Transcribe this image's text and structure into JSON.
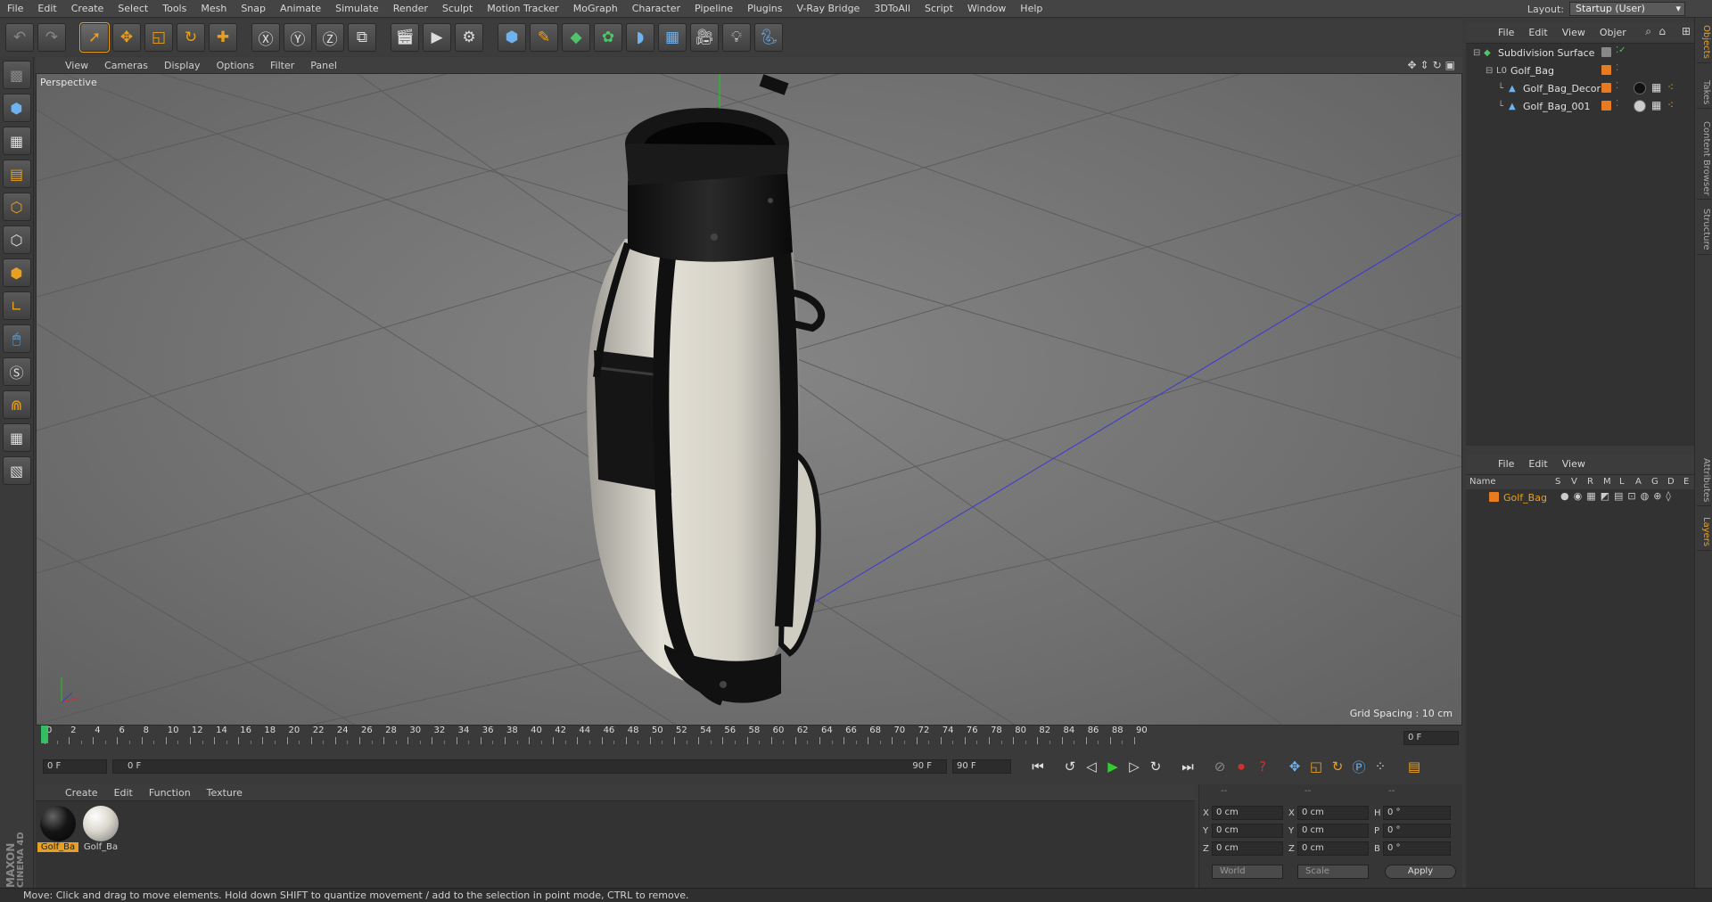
{
  "menubar": {
    "items": [
      "File",
      "Edit",
      "Create",
      "Select",
      "Tools",
      "Mesh",
      "Snap",
      "Animate",
      "Simulate",
      "Render",
      "Sculpt",
      "Motion Tracker",
      "MoGraph",
      "Character",
      "Pipeline",
      "Plugins",
      "V-Ray Bridge",
      "3DToAll",
      "Script",
      "Window",
      "Help"
    ],
    "layout_label": "Layout:",
    "layout_value": "Startup (User)"
  },
  "viewport": {
    "menu": [
      "View",
      "Cameras",
      "Display",
      "Options",
      "Filter",
      "Panel"
    ],
    "label": "Perspective",
    "grid_spacing": "Grid Spacing : 10 cm"
  },
  "timeline": {
    "ticks": [
      "0",
      "2",
      "4",
      "6",
      "8",
      "10",
      "12",
      "14",
      "16",
      "18",
      "20",
      "22",
      "24",
      "26",
      "28",
      "30",
      "32",
      "34",
      "36",
      "38",
      "40",
      "42",
      "44",
      "46",
      "48",
      "50",
      "52",
      "54",
      "56",
      "58",
      "60",
      "62",
      "64",
      "66",
      "68",
      "70",
      "72",
      "74",
      "76",
      "78",
      "80",
      "82",
      "84",
      "86",
      "88",
      "90"
    ],
    "current_frame": "0 F",
    "start_field": "0 F",
    "range_start": "0 F",
    "range_end": "90 F",
    "end_field": "90 F"
  },
  "material_manager": {
    "menu": [
      "Create",
      "Edit",
      "Function",
      "Texture"
    ],
    "materials": [
      {
        "name": "Golf_Ba",
        "color": "#151515",
        "selected": true
      },
      {
        "name": "Golf_Ba",
        "color": "#d9d6cc",
        "selected": false
      }
    ]
  },
  "coordinates": {
    "headers": [
      "--",
      "--",
      "--"
    ],
    "rows": [
      {
        "a1": "X",
        "v1": "0 cm",
        "a2": "X",
        "v2": "0 cm",
        "a3": "H",
        "v3": "0 °"
      },
      {
        "a1": "Y",
        "v1": "0 cm",
        "a2": "Y",
        "v2": "0 cm",
        "a3": "P",
        "v3": "0 °"
      },
      {
        "a1": "Z",
        "v1": "0 cm",
        "a2": "Z",
        "v2": "0 cm",
        "a3": "B",
        "v3": "0 °"
      }
    ],
    "mode_world": "World",
    "mode_scale": "Scale",
    "apply_label": "Apply"
  },
  "object_manager": {
    "menu": [
      "File",
      "Edit",
      "View",
      "Objer"
    ],
    "objects": [
      {
        "name": "Subdivision Surface",
        "indent": 0,
        "icon_color": "#4fc46a"
      },
      {
        "name": "Golf_Bag",
        "indent": 1,
        "icon_color": "#bbbbbb"
      },
      {
        "name": "Golf_Bag_Decor",
        "indent": 2,
        "icon_color": "#6fb2f0"
      },
      {
        "name": "Golf_Bag_001",
        "indent": 2,
        "icon_color": "#6fb2f0"
      }
    ]
  },
  "layer_manager": {
    "menu": [
      "File",
      "Edit",
      "View"
    ],
    "columns": [
      "Name",
      "S",
      "V",
      "R",
      "M",
      "L",
      "A",
      "G",
      "D",
      "E"
    ],
    "layers": [
      {
        "name": "Golf_Bag",
        "color": "#e87a20"
      }
    ]
  },
  "side_tabs": [
    "Objects",
    "Takes",
    "Content Browser",
    "Structure",
    "Attributes",
    "Layers"
  ],
  "brand": {
    "line1": "MAXON",
    "line2": "CINEMA 4D"
  },
  "status": "Move: Click and drag to move elements. Hold down SHIFT to quantize movement / add to the selection in point mode, CTRL to remove.",
  "colors": {
    "accent": "#e8a020",
    "bg": "#3a3a3a"
  }
}
